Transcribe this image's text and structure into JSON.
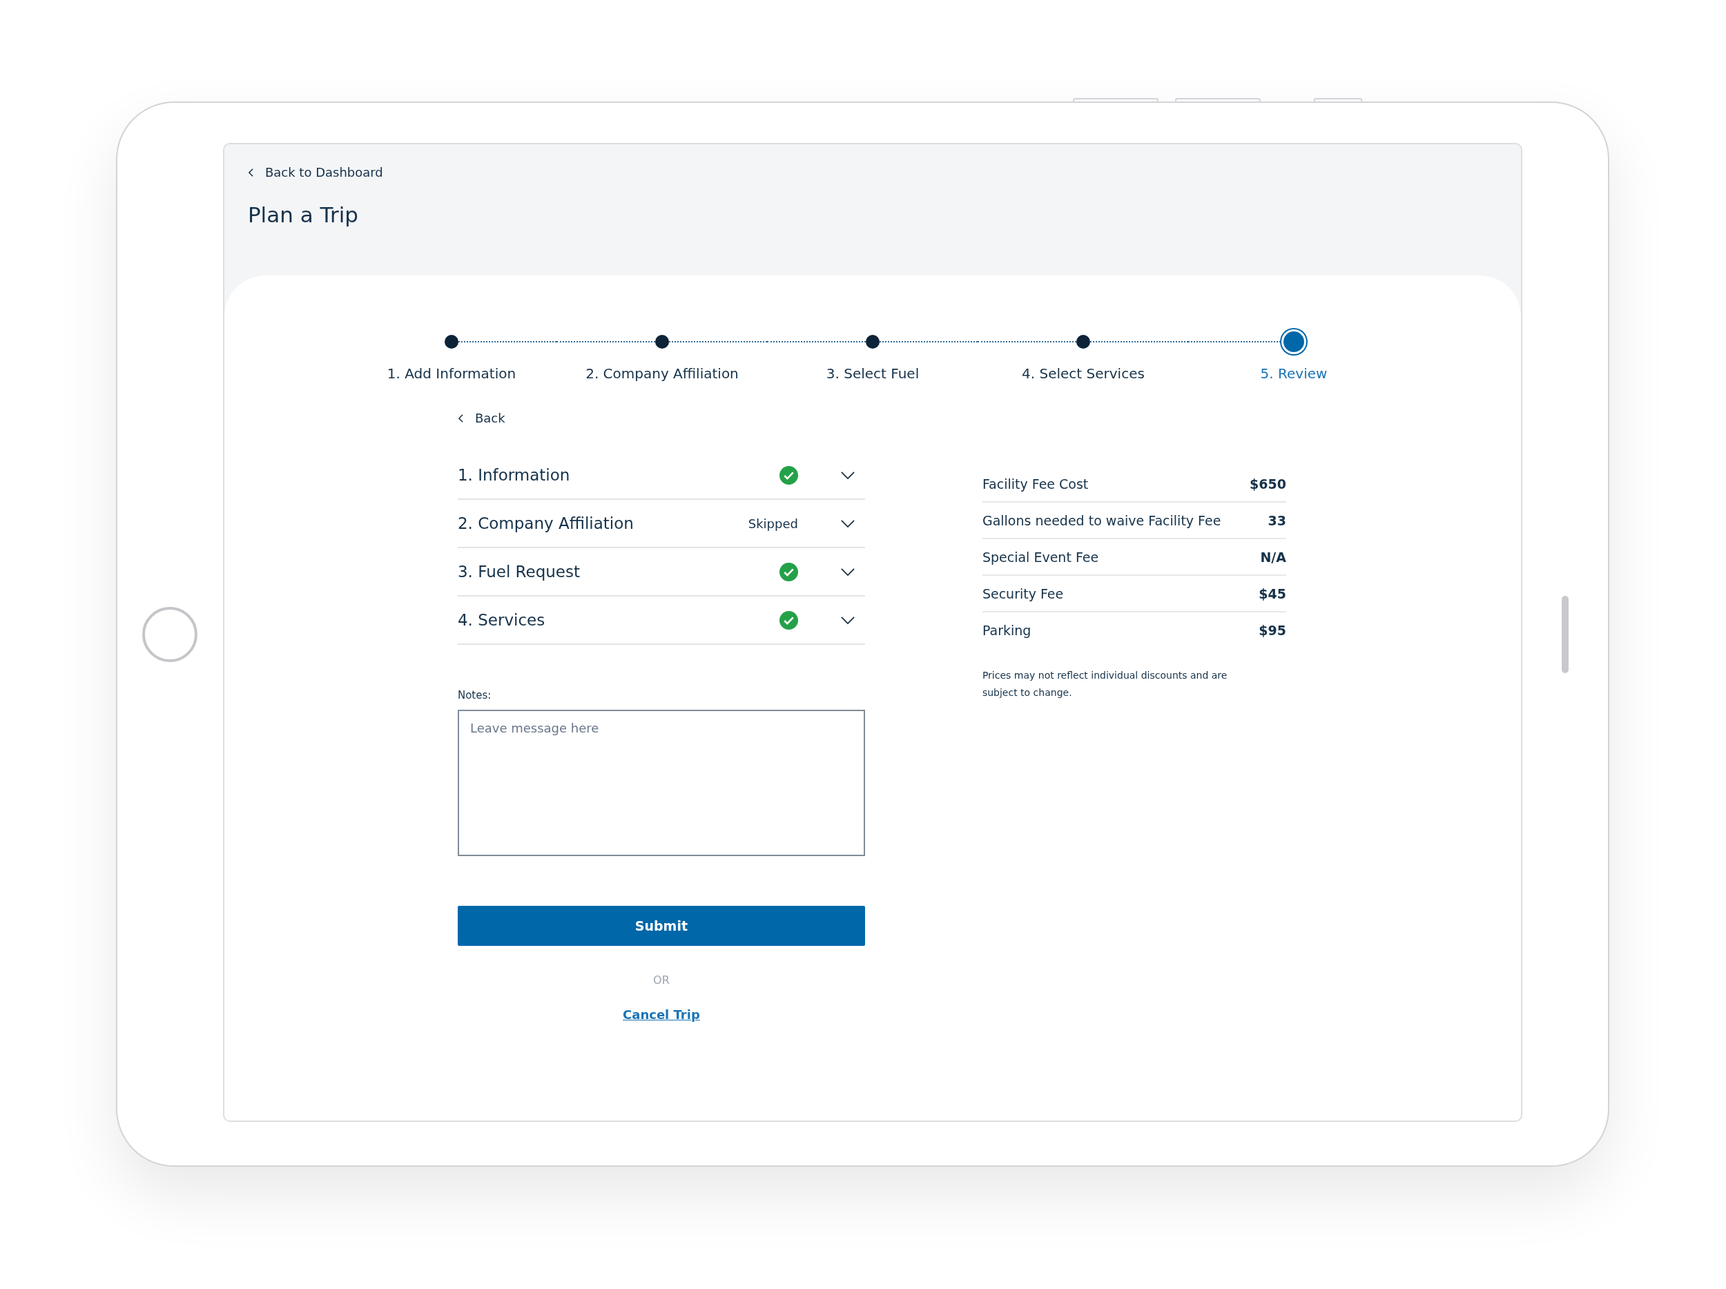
{
  "header": {
    "back_link": "Back to Dashboard",
    "title": "Plan a Trip"
  },
  "steps": [
    {
      "label": "1. Add Information",
      "selected": false
    },
    {
      "label": "2. Company Affiliation",
      "selected": false
    },
    {
      "label": "3. Select Fuel",
      "selected": false
    },
    {
      "label": "4. Select Services",
      "selected": false
    },
    {
      "label": "5. Review",
      "selected": true
    }
  ],
  "back_link": "Back",
  "sections": [
    {
      "title": "1. Information",
      "completed": true,
      "expanded": false
    },
    {
      "title": "2. Company Affiliation",
      "completed": false,
      "status": "Skipped",
      "expanded": false
    },
    {
      "title": "3. Fuel Request",
      "completed": true,
      "expanded": false
    },
    {
      "title": "4. Services",
      "completed": true,
      "expanded": false
    }
  ],
  "notes": {
    "label": "Notes:",
    "placeholder": "Leave message here"
  },
  "submit": "Submit",
  "separator": "OR",
  "cancel_link": "Cancel Trip",
  "fees": [
    {
      "label": "Facility Fee Cost",
      "value": "$650"
    },
    {
      "label": "Gallons needed to waive Facility Fee",
      "value": "33"
    },
    {
      "label": "Special Event Fee",
      "value": "N/A"
    },
    {
      "label": "Security Fee",
      "value": "$45"
    },
    {
      "label": "Parking",
      "value": "$95"
    }
  ],
  "disclaimer": "Prices may not reflect individual discounts and are subject to change."
}
